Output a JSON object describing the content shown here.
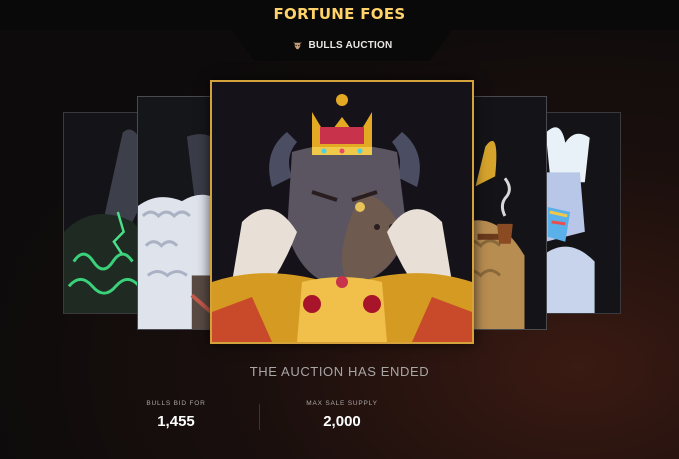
{
  "header": {
    "title": "FORTUNE FOES"
  },
  "tab": {
    "label": "BULLS AUCTION",
    "icon": "bull-head-icon"
  },
  "carousel": {
    "cards": [
      {
        "name": "green-rune-bull"
      },
      {
        "name": "white-fur-bull"
      },
      {
        "name": "crowned-king-bull"
      },
      {
        "name": "pipe-smoking-bull"
      },
      {
        "name": "white-rainbow-bull"
      }
    ],
    "active_index": 2
  },
  "auction": {
    "status": "THE AUCTION HAS ENDED",
    "stats": [
      {
        "label": "BULLS BID FOR",
        "value": "1,455"
      },
      {
        "label": "MAX SALE SUPPLY",
        "value": "2,000"
      }
    ]
  },
  "colors": {
    "accent": "#ffd36a",
    "frame": "#d4a23a"
  }
}
